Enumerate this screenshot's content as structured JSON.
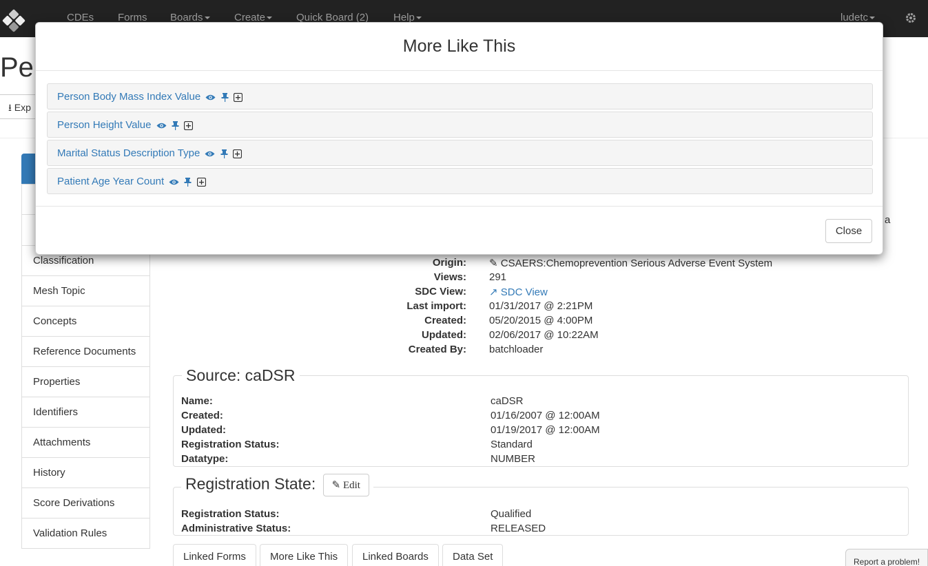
{
  "navbar": {
    "items": [
      {
        "label": "CDEs"
      },
      {
        "label": "Forms"
      },
      {
        "label": "Boards",
        "dropdown": true
      },
      {
        "label": "Create",
        "dropdown": true
      },
      {
        "label": "Quick Board (2)"
      },
      {
        "label": "Help",
        "dropdown": true
      }
    ],
    "user": "ludetc"
  },
  "page": {
    "title_partial": "Per",
    "export_partial": "Exp",
    "truncated_char": "a"
  },
  "sidebar": {
    "items": [
      {
        "label": "Classification"
      },
      {
        "label": "Mesh Topic"
      },
      {
        "label": "Concepts"
      },
      {
        "label": "Reference Documents"
      },
      {
        "label": "Properties"
      },
      {
        "label": "Identifiers"
      },
      {
        "label": "Attachments"
      },
      {
        "label": "History"
      },
      {
        "label": "Score Derivations"
      },
      {
        "label": "Validation Rules"
      }
    ]
  },
  "details": {
    "origin_label": "Origin:",
    "origin_value": "CSAERS:Chemoprevention Serious Adverse Event System",
    "views_label": "Views:",
    "views_value": "291",
    "sdc_label": "SDC View:",
    "sdc_value": "SDC View",
    "last_import_label": "Last import:",
    "last_import_value": "01/31/2017 @ 2:21PM",
    "created_label": "Created:",
    "created_value": "05/20/2015 @ 4:00PM",
    "updated_label": "Updated:",
    "updated_value": "02/06/2017 @ 10:22AM",
    "created_by_label": "Created By:",
    "created_by_value": "batchloader"
  },
  "source": {
    "legend": "Source: caDSR",
    "rows": [
      {
        "label": "Name:",
        "value": "caDSR"
      },
      {
        "label": "Created:",
        "value": "01/16/2007 @ 12:00AM"
      },
      {
        "label": "Updated:",
        "value": "01/19/2017 @ 12:00AM"
      },
      {
        "label": "Registration Status:",
        "value": "Standard"
      },
      {
        "label": "Datatype:",
        "value": "NUMBER"
      }
    ]
  },
  "registration": {
    "legend": "Registration State:",
    "edit_label": "Edit",
    "rows": [
      {
        "label": "Registration Status:",
        "value": "Qualified"
      },
      {
        "label": "Administrative Status:",
        "value": "RELEASED"
      }
    ]
  },
  "tabs": [
    {
      "label": "Linked Forms"
    },
    {
      "label": "More Like This"
    },
    {
      "label": "Linked Boards"
    },
    {
      "label": "Data Set"
    }
  ],
  "report_label": "Report a problem!",
  "modal": {
    "title": "More Like This",
    "results": [
      {
        "name": "Person Body Mass Index Value"
      },
      {
        "name": "Person Height Value"
      },
      {
        "name": "Marital Status Description Type"
      },
      {
        "name": "Patient Age Year Count"
      }
    ],
    "close_label": "Close"
  },
  "colors": {
    "navbar_bg": "#222222",
    "link": "#337ab7",
    "active": "#337ab7"
  }
}
